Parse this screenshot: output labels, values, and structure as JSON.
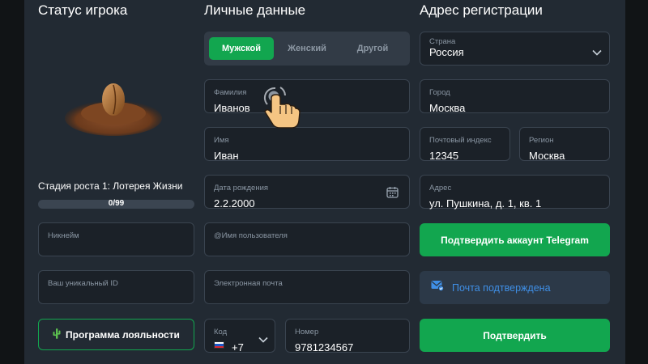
{
  "status": {
    "heading": "Статус игрока",
    "stage_text": "Стадия роста 1: Лотерея Жизни",
    "progress_text": "0/99",
    "progress_fraction": 0,
    "nickname_label": "Никнейм",
    "unique_id_label": "Ваш уникальный ID",
    "loyalty_button": "Программа лояльности"
  },
  "personal": {
    "heading": "Личные данные",
    "gender_options": [
      "Мужской",
      "Женский",
      "Другой"
    ],
    "gender_selected": "Мужской",
    "surname_label": "Фамилия",
    "surname_value": "Иванов",
    "name_label": "Имя",
    "name_value": "Иван",
    "birth_label": "Дата рождения",
    "birth_value": "2.2.2000",
    "username_label": "@Имя пользователя",
    "email_label": "Электронная почта",
    "code_label": "Код",
    "code_value": "+7",
    "phone_label": "Номер",
    "phone_value": "9781234567"
  },
  "address": {
    "heading": "Адрес регистрации",
    "country_label": "Страна",
    "country_value": "Россия",
    "city_label": "Город",
    "city_value": "Москва",
    "postal_label": "Почтовый индекс",
    "postal_value": "12345",
    "region_label": "Регион",
    "region_value": "Москва",
    "address_label": "Адрес",
    "address_value": "ул. Пушкина, д. 1, кв. 1",
    "telegram_button": "Подтвердить аккаунт Telegram",
    "email_confirmed": "Почта подтверждена",
    "confirm_button": "Подтвердить"
  },
  "colors": {
    "accent_green": "#12a64f",
    "confirmed_blue": "#3f8fe6",
    "panel": "#222a33"
  }
}
